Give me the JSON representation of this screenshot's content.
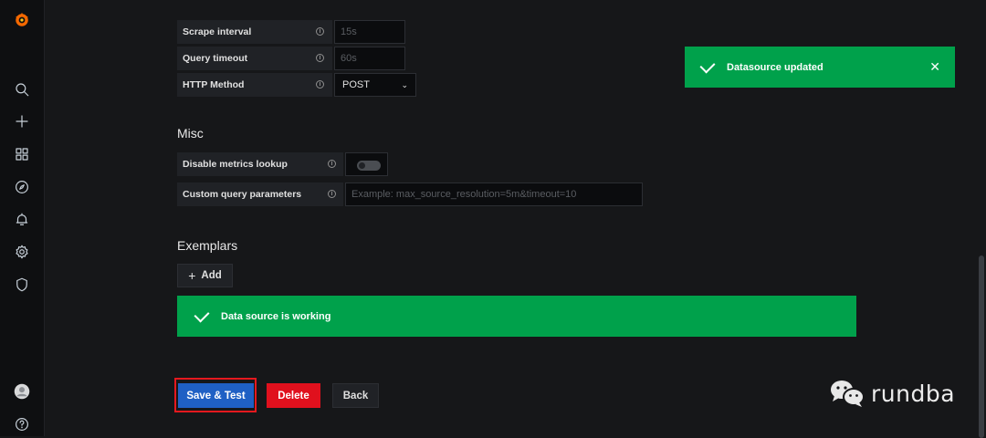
{
  "settings": {
    "scrape_interval": {
      "label": "Scrape interval",
      "placeholder": "15s"
    },
    "query_timeout": {
      "label": "Query timeout",
      "placeholder": "60s"
    },
    "http_method": {
      "label": "HTTP Method",
      "value": "POST"
    }
  },
  "misc": {
    "title": "Misc",
    "disable_metrics": {
      "label": "Disable metrics lookup"
    },
    "custom_query": {
      "label": "Custom query parameters",
      "placeholder": "Example: max_source_resolution=5m&timeout=10"
    }
  },
  "exemplars": {
    "title": "Exemplars",
    "add_label": "Add"
  },
  "status": {
    "working": "Data source is working"
  },
  "toast": {
    "message": "Datasource updated"
  },
  "actions": {
    "save": "Save & Test",
    "delete": "Delete",
    "back": "Back"
  },
  "watermark": {
    "text": "rundba"
  },
  "colors": {
    "success": "#00a14b",
    "primary": "#1f60c4",
    "danger": "#e0101d",
    "brand_orange": "#f46800"
  }
}
